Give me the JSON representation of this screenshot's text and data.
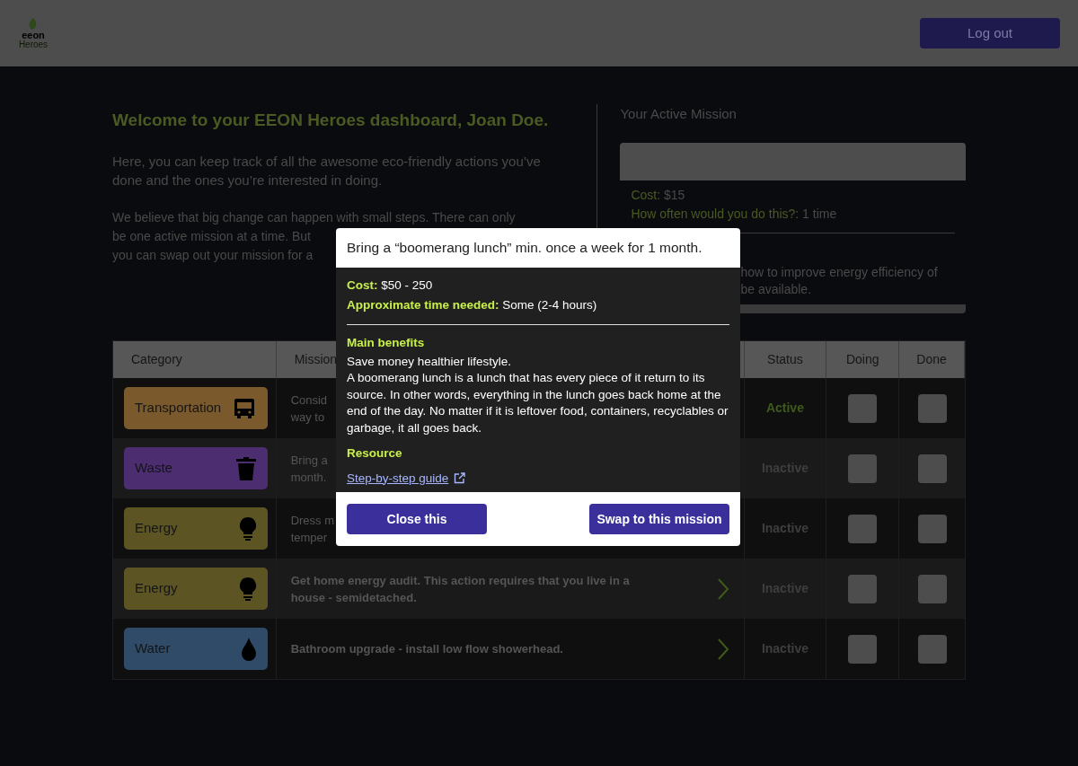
{
  "header": {
    "logo_top": "eeon",
    "logo_bottom": "Heroes",
    "logout": "Log out"
  },
  "welcome": {
    "title": "Welcome to your EEON Heroes dashboard, Joan Doe.",
    "intro": "Here, you can keep track of all the awesome eco-friendly actions you’ve done and the ones you’re interested in doing.",
    "lines": [
      "We believe that big change can happen with small steps. There can only",
      "be one active mission at a time. But",
      "you can swap out your mission for a"
    ]
  },
  "active_mission": {
    "heading": "Your Active Mission",
    "cost_label": "Cost:",
    "cost": "$15",
    "often_label": "How often would you do this?:",
    "often": "1 time",
    "lines": [
      "how to improve energy efficiency of",
      "be available."
    ]
  },
  "table": {
    "columns": [
      "Category",
      "Mission",
      "Status",
      "Doing",
      "Done"
    ],
    "rows": [
      {
        "category": "Transportation",
        "kind": "bus",
        "color": "#7a5a2c",
        "mission": [
          "Consid",
          "way to"
        ],
        "chevron": false,
        "status": "Active",
        "active": true,
        "doing": false,
        "done": false
      },
      {
        "category": "Waste",
        "kind": "bin",
        "color": "#4b2d70",
        "mission": [
          "Bring a",
          "month."
        ],
        "chevron": false,
        "status": "Inactive",
        "active": false,
        "doing": false,
        "done": false
      },
      {
        "category": "Energy",
        "kind": "bulb",
        "color": "#5d5424",
        "mission": [
          "Dress m",
          "temper"
        ],
        "chevron": false,
        "status": "Inactive",
        "active": false,
        "doing": false,
        "done": false
      },
      {
        "category": "Energy",
        "kind": "bulb",
        "color": "#5d5424",
        "mission": [
          "Get home energy audit. This action requires that you live in a",
          "house - semidetached."
        ],
        "chevron": true,
        "status": "Inactive",
        "active": false,
        "doing": false,
        "done": false
      },
      {
        "category": "Water",
        "kind": "drop",
        "color": "#304b68",
        "mission": [
          "Bathroom upgrade - install low flow showerhead."
        ],
        "chevron": true,
        "status": "Inactive",
        "active": false,
        "doing": false,
        "done": false
      }
    ]
  },
  "modal": {
    "title": "Bring a “boomerang lunch” min. once a week for 1 month.",
    "cost_label": "Cost:",
    "cost": "$50 - 250",
    "time_label": "Approximate time needed:",
    "time": "Some (2-4 hours)",
    "benefits_heading": "Main benefits",
    "benefits": [
      "Save money healthier lifestyle.",
      "A boomerang lunch is a lunch that has every piece of it return to its source. In other words, everything in the lunch goes back home at the end of the day. No matter if it is leftover food, containers, recyclables or garbage, it all goes back."
    ],
    "resource_heading": "Resource",
    "resource_link": "Step-by-step guide",
    "close": "Close this",
    "swap": "Swap to this mission"
  }
}
